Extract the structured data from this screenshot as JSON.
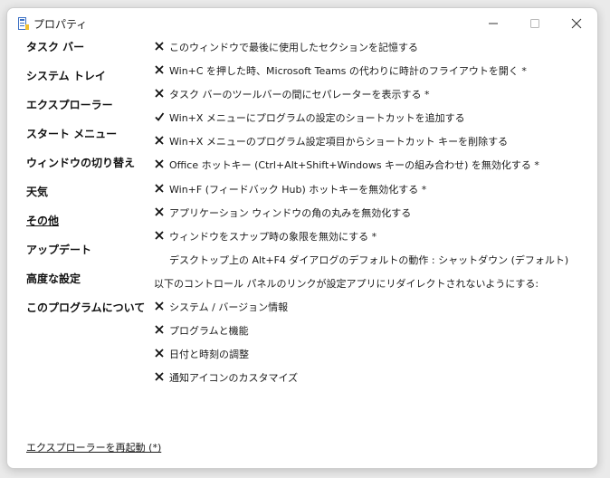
{
  "window": {
    "title": "プロパティ",
    "icons": {
      "app": "app-icon",
      "minimize": "minimize-icon",
      "maximize": "maximize-icon",
      "close": "close-icon"
    }
  },
  "nav": {
    "items": [
      {
        "label": "タスク バー"
      },
      {
        "label": "システム トレイ"
      },
      {
        "label": "エクスプローラー"
      },
      {
        "label": "スタート メニュー"
      },
      {
        "label": "ウィンドウの切り替え"
      },
      {
        "label": "天気"
      },
      {
        "label": "その他",
        "current": true
      },
      {
        "label": "アップデート"
      },
      {
        "label": "高度な設定"
      },
      {
        "label": "このプログラムについて"
      }
    ]
  },
  "settings": {
    "rows": [
      {
        "state": "unchecked",
        "label": "このウィンドウで最後に使用したセクションを記憶する"
      },
      {
        "state": "unchecked",
        "label": "Win+C を押した時、Microsoft Teams の代わりに時計のフライアウトを開く *"
      },
      {
        "state": "unchecked",
        "label": "タスク バーのツールバーの間にセパレーターを表示する *"
      },
      {
        "state": "checked",
        "label": "Win+X メニューにプログラムの設定のショートカットを追加する"
      },
      {
        "state": "unchecked",
        "label": "Win+X メニューのプログラム設定項目からショートカット キーを削除する"
      },
      {
        "state": "unchecked",
        "label": "Office ホットキー (Ctrl+Alt+Shift+Windows キーの組み合わせ) を無効化する *"
      },
      {
        "state": "unchecked",
        "label": "Win+F (フィードバック Hub) ホットキーを無効化する *"
      },
      {
        "state": "unchecked",
        "label": "アプリケーション ウィンドウの角の丸みを無効化する"
      },
      {
        "state": "unchecked",
        "label": "ウィンドウをスナップ時の象限を無効にする *"
      },
      {
        "state": "dropdown",
        "label": "デスクトップ上の Alt+F4 ダイアログのデフォルトの動作 : シャットダウン (デフォルト)"
      },
      {
        "state": "text",
        "label": "以下のコントロール パネルのリンクが設定アプリにリダイレクトされないようにする:"
      },
      {
        "state": "unchecked",
        "label": "システム / バージョン情報"
      },
      {
        "state": "unchecked",
        "label": "プログラムと機能"
      },
      {
        "state": "unchecked",
        "label": "日付と時刻の調整"
      },
      {
        "state": "unchecked",
        "label": "通知アイコンのカスタマイズ"
      }
    ]
  },
  "footer": {
    "restart_label": "エクスプローラーを再起動 (*)"
  }
}
